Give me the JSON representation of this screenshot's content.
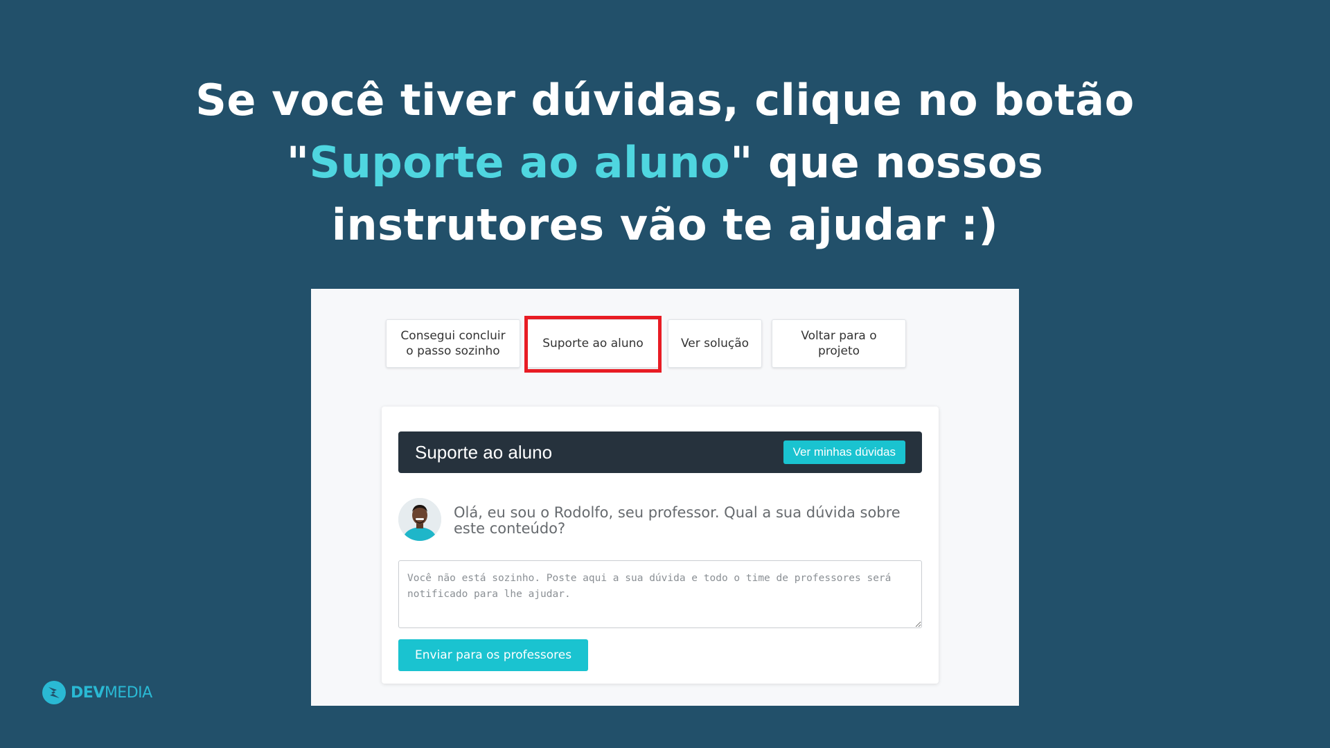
{
  "headline": {
    "line1": "Se você tiver dúvidas, clique no botão",
    "line2_quote_open": "\"",
    "line2_highlight": "Suporte ao aluno",
    "line2_rest": "\" que nossos",
    "line3": "instrutores vão te ajudar :)"
  },
  "colors": {
    "background": "#22506a",
    "highlight_text": "#4fd6e0",
    "accent": "#1ac3d0",
    "highlight_border": "#e81c24",
    "header_bar": "#26323d"
  },
  "buttons": [
    {
      "line1": "Consegui concluir",
      "line2": "o passo sozinho"
    },
    {
      "line1": "Suporte ao aluno",
      "line2": ""
    },
    {
      "line1": "Ver solução",
      "line2": ""
    },
    {
      "line1": "Voltar para o",
      "line2": "projeto"
    }
  ],
  "support_panel": {
    "title": "Suporte ao aluno",
    "header_button": "Ver minhas dúvidas",
    "greeting": "Olá, eu sou o Rodolfo, seu professor. Qual a sua dúvida sobre este conteúdo?",
    "textarea_placeholder": "Você não está sozinho. Poste aqui a sua dúvida e todo o time de professores será notificado para lhe ajudar.",
    "submit_button": "Enviar para os professores"
  },
  "logo": {
    "part1": "DEV",
    "part2": "MEDIA",
    "icon": "devmedia-logo-icon"
  }
}
